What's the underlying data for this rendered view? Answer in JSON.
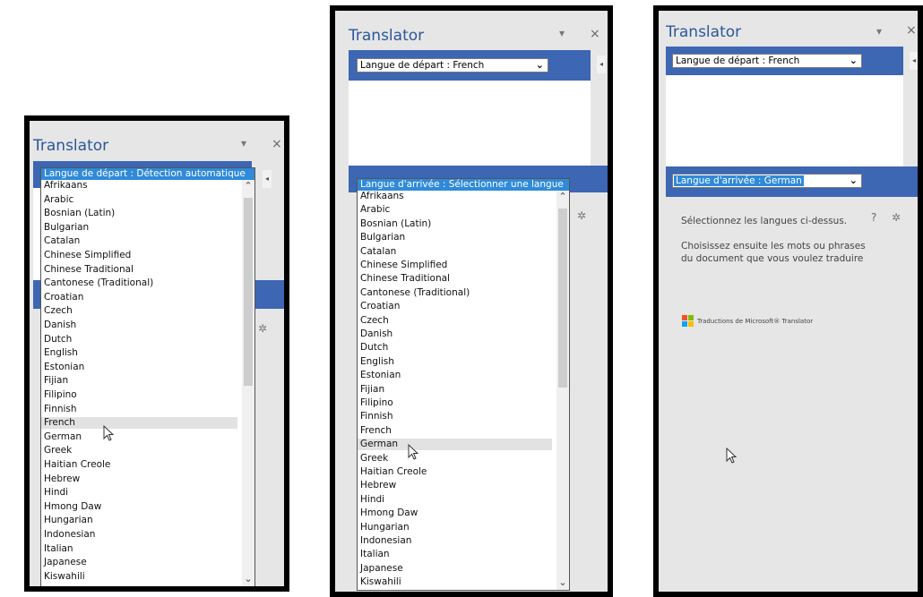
{
  "colors": {
    "title": "#2b579a",
    "band": "#3d66b3",
    "selection": "#2f8ad9"
  },
  "panel1": {
    "title": "Translator",
    "source_combo": "Langue de départ : Détection automatique",
    "languages": [
      "Afrikaans",
      "Arabic",
      "Bosnian (Latin)",
      "Bulgarian",
      "Catalan",
      "Chinese Simplified",
      "Chinese Traditional",
      "Cantonese (Traditional)",
      "Croatian",
      "Czech",
      "Danish",
      "Dutch",
      "English",
      "Estonian",
      "Fijian",
      "Filipino",
      "Finnish",
      "French",
      "German",
      "Greek",
      "Haitian Creole",
      "Hebrew",
      "Hindi",
      "Hmong Daw",
      "Hungarian",
      "Indonesian",
      "Italian",
      "Japanese",
      "Kiswahili"
    ],
    "hovered": "French"
  },
  "panel2": {
    "title": "Translator",
    "source_combo": "Langue de départ : French",
    "target_combo": "Langue d'arrivée : Sélectionner une langue",
    "languages": [
      "Afrikaans",
      "Arabic",
      "Bosnian (Latin)",
      "Bulgarian",
      "Catalan",
      "Chinese Simplified",
      "Chinese Traditional",
      "Cantonese (Traditional)",
      "Croatian",
      "Czech",
      "Danish",
      "Dutch",
      "English",
      "Estonian",
      "Fijian",
      "Filipino",
      "Finnish",
      "French",
      "German",
      "Greek",
      "Haitian Creole",
      "Hebrew",
      "Hindi",
      "Hmong Daw",
      "Hungarian",
      "Indonesian",
      "Italian",
      "Japanese",
      "Kiswahili"
    ],
    "hovered": "German"
  },
  "panel3": {
    "title": "Translator",
    "source_combo": "Langue de départ : French",
    "target_combo": "Langue d'arrivée : German",
    "instruction1": "Sélectionnez les langues ci-dessus.",
    "instruction2_line1": "Choisissez ensuite les mots ou phrases",
    "instruction2_line2": "du document que vous voulez traduire",
    "help": "?",
    "credit": "Traductions de Microsoft® Translator"
  },
  "icons": {
    "dropdown": "▾",
    "close": "×",
    "combo_arrow": "⌄",
    "collapse": "◂",
    "gear": "✲",
    "scroll_up": "⌃",
    "scroll_down": "⌄"
  }
}
